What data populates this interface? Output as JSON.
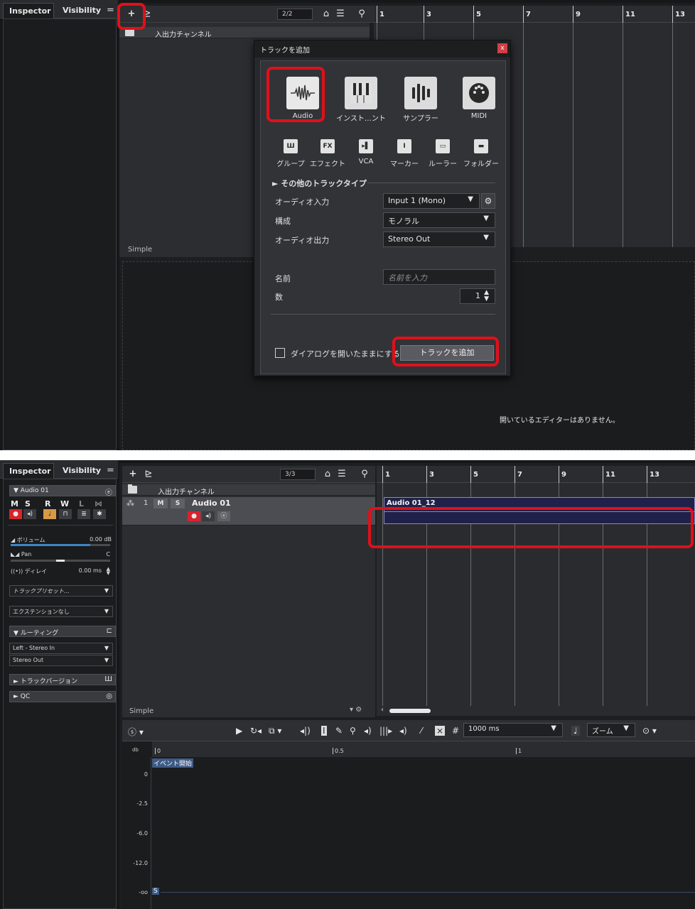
{
  "top": {
    "tabs": {
      "inspector": "Inspector",
      "visibility": "Visibility",
      "menu": "="
    },
    "toolbar": {
      "add": "+",
      "counter": "2/2"
    },
    "ruler": [
      "1",
      "3",
      "5",
      "7",
      "9",
      "11",
      "13"
    ],
    "folder_track": "入出力チャンネル",
    "simple": "Simple",
    "no_editor": "開いているエディターはありません。",
    "dialog": {
      "title": "トラックを追加",
      "close": "x",
      "big_types": [
        "Audio",
        "インスト…ント",
        "サンプラー",
        "MIDI"
      ],
      "small_types": [
        {
          "icon": "Ш",
          "label": "グループ"
        },
        {
          "icon": "FX",
          "label": "エフェクト"
        },
        {
          "icon": "▸▌",
          "label": "VCA"
        },
        {
          "icon": "Ӏ",
          "label": "マーカー"
        },
        {
          "icon": "▭",
          "label": "ルーラー"
        },
        {
          "icon": "▬",
          "label": "フォルダー"
        }
      ],
      "other_types": "► その他のトラックタイプ",
      "audio_input_label": "オーディオ入力",
      "audio_input_value": "Input 1 (Mono)",
      "config_label": "構成",
      "config_value": "モノラル",
      "audio_output_label": "オーディオ出力",
      "audio_output_value": "Stereo Out",
      "name_label": "名前",
      "name_placeholder": "名前を入力",
      "count_label": "数",
      "count_value": "1",
      "keep_open": "ダイアログを開いたままにする",
      "add_button": "トラックを追加"
    }
  },
  "bottom": {
    "tabs": {
      "inspector": "Inspector",
      "visibility": "Visibility",
      "menu": "="
    },
    "toolbar": {
      "add": "+",
      "counter": "3/3"
    },
    "ruler": [
      "1",
      "3",
      "5",
      "7",
      "9",
      "11",
      "13"
    ],
    "folder_track": "入出力チャンネル",
    "track": {
      "number": "1",
      "m": "M",
      "s": "S",
      "name": "Audio 01"
    },
    "event_name": "Audio 01_12",
    "simple": "Simple",
    "inspector": {
      "track_name": "▼ Audio 01",
      "buttons": [
        "M",
        "S",
        "R",
        "W",
        "L",
        "⋈"
      ],
      "volume_label": "◢ ボリューム",
      "volume_value": "0.00 dB",
      "volume_level": 0.8,
      "pan_label": "◣◢ Pan",
      "pan_value": "C",
      "delay_label": "((•)) ディレイ",
      "delay_value": "0.00 ms",
      "track_preset": "トラックプリセット…",
      "extension": "エクステンションなし",
      "routing": "▼ ルーティング",
      "routing_in": "Left - Stereo In",
      "routing_out": "Stereo Out",
      "track_versions": "► トラックバージョン",
      "qc": "► QC"
    },
    "editor": {
      "time_value": "1000 ms",
      "zoom": "ズーム",
      "ruler": [
        "0",
        "0.5",
        "1"
      ],
      "event_start": "イベント開始",
      "db_unit": "db",
      "db_labels": [
        "0",
        "-2.5",
        "-6.0",
        "-12.0",
        "-oo"
      ],
      "s_marker": "S"
    }
  }
}
